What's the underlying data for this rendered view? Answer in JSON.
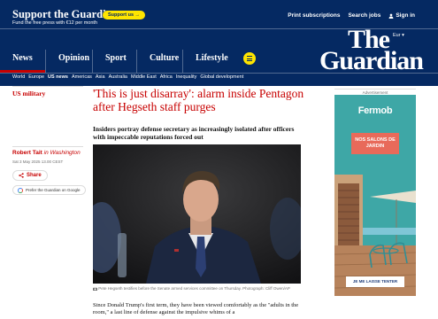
{
  "header": {
    "support_title": "Support the Guardian",
    "support_sub": "Fund the free press with €12 per month",
    "support_button": "Support us →",
    "top_links": {
      "print": "Print subscriptions",
      "jobs": "Search jobs",
      "signin": "Sign in"
    },
    "edition": "Eur ▾",
    "logo_line1": "The",
    "logo_line2": "Guardian",
    "pillars": [
      "News",
      "Opinion",
      "Sport",
      "Culture",
      "Lifestyle"
    ],
    "active_pillar": "News",
    "subnav": [
      "World",
      "Europe",
      "US news",
      "Americas",
      "Asia",
      "Australia",
      "Middle East",
      "Africa",
      "Inequality",
      "Global development"
    ],
    "active_subnav": "US news"
  },
  "article": {
    "section": "US military",
    "headline": "'This is just disarray': alarm inside Pentagon after Hegseth staff purges",
    "standfirst": "Insiders portray defense secretary as increasingly isolated after officers with impeccable reputations forced out",
    "author_name": "Robert Tait",
    "author_location": "in Washington",
    "dateline": "Sat 3 May 2025 13.00 CEST",
    "share_label": "Share",
    "prefer_label": "Prefer the Guardian on Google",
    "caption": "Pete Hegseth testifies before the Senate armed services committee on Thursday. Photograph: Cliff Owen/AP",
    "body": "Since Donald Trump's first term, they have been viewed comfortably as the \"adults in the room,\" a last line of defense against the impulsive whims of a"
  },
  "ad": {
    "label": "Advertisement",
    "brand": "Fermob",
    "banner": "NOS SALONS DE JARDIN",
    "cta": "JE ME LAISSE TENTER"
  },
  "colors": {
    "brand_blue": "#052962",
    "accent_red": "#c70000",
    "support_yellow": "#ffe500",
    "ad_teal": "#3ea7a6"
  }
}
